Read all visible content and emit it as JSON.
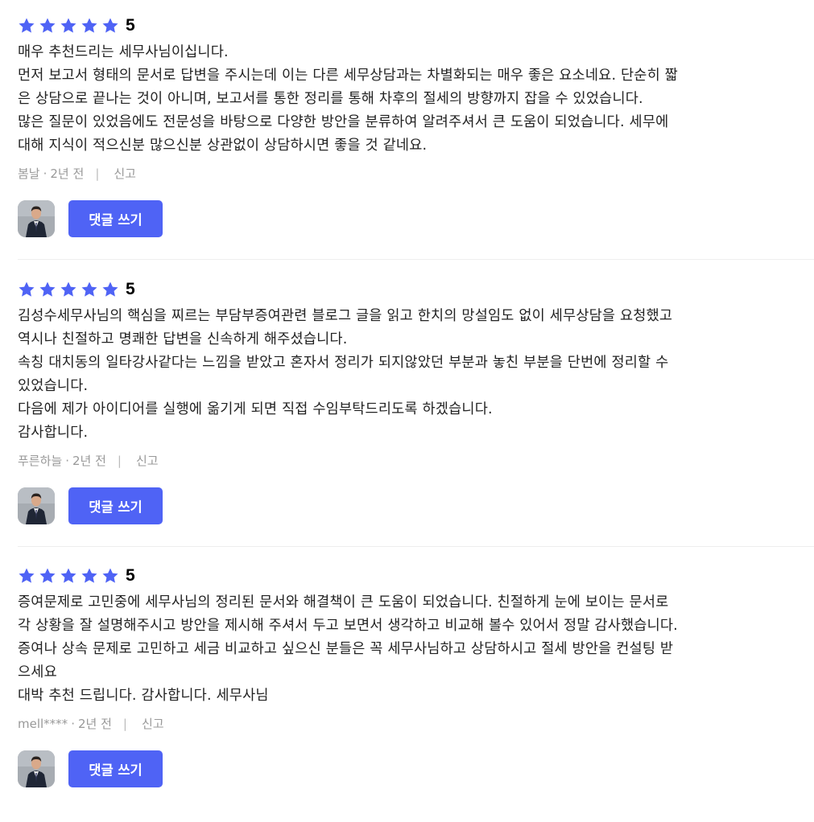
{
  "star_color": "#4f63f5",
  "reply_button_color": "#4f63f5",
  "reviews": [
    {
      "rating": 5,
      "score_text": "5",
      "lines": [
        "매우 추천드리는 세무사님이십니다.",
        "먼저 보고서 형태의 문서로 답변을 주시는데 이는 다른 세무상담과는 차별화되는 매우 좋은 요소네요. 단순히 짧",
        "은 상담으로 끝나는 것이 아니며, 보고서를 통한 정리를 통해 차후의 절세의 방향까지 잡을 수 있었습니다.",
        "많은 질문이 있었음에도 전문성을 바탕으로 다양한 방안을 분류하여 알려주셔서 큰 도움이 되었습니다. 세무에",
        "대해 지식이 적으신분 많으신분 상관없이 상담하시면 좋을 것 같네요."
      ],
      "author": "봄날",
      "time": "2년 전",
      "report_label": "신고",
      "reply_label": "댓글 쓰기"
    },
    {
      "rating": 5,
      "score_text": "5",
      "lines": [
        "김성수세무사님의 핵심을 찌르는 부담부증여관련 블로그 글을 읽고 한치의 망설임도 없이 세무상담을 요청했고",
        "역시나 친절하고 명쾌한 답변을 신속하게 해주셨습니다.",
        "속칭 대치동의 일타강사같다는 느낌을 받았고 혼자서 정리가 되지않았던 부분과 놓친 부분을 단번에 정리할 수",
        "있었습니다.",
        "다음에 제가 아이디어를 실행에 옮기게 되면 직접 수임부탁드리도록 하겠습니다.",
        "감사합니다."
      ],
      "author": "푸른하늘",
      "time": "2년 전",
      "report_label": "신고",
      "reply_label": "댓글 쓰기"
    },
    {
      "rating": 5,
      "score_text": "5",
      "lines": [
        "증여문제로 고민중에 세무사님의 정리된 문서와 해결책이 큰 도움이 되었습니다. 친절하게 눈에 보이는 문서로",
        "각 상황을 잘 설명해주시고 방안을 제시해 주셔서 두고 보면서 생각하고 비교해 볼수 있어서 정말 감사했습니다.",
        "증여나 상속 문제로 고민하고 세금 비교하고 싶으신 분들은 꼭 세무사님하고 상담하시고 절세 방안을 컨설팅 받",
        "으세요",
        "대박 추천 드립니다. 감사합니다. 세무사님"
      ],
      "author": "mell****",
      "time": "2년 전",
      "report_label": "신고",
      "reply_label": "댓글 쓰기"
    }
  ]
}
